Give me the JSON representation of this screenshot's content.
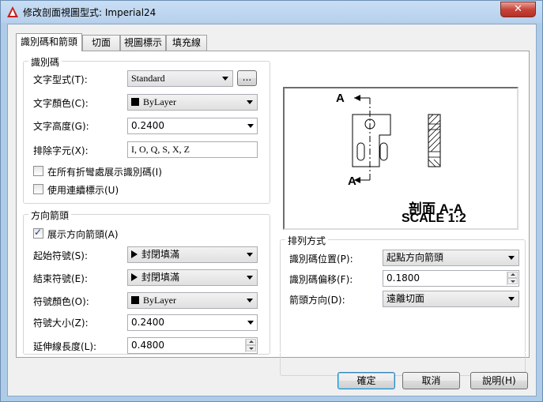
{
  "window": {
    "title": "修改剖面視圖型式: Imperial24",
    "close_glyph": "✕"
  },
  "tabs": [
    {
      "label": "識別碼和箭頭"
    },
    {
      "label": "切面"
    },
    {
      "label": "視圖標示"
    },
    {
      "label": "填充線"
    }
  ],
  "identifier": {
    "group_title": "識別碼",
    "text_style_label": "文字型式(T):",
    "text_style_value": "Standard",
    "text_style_browse": "...",
    "text_color_label": "文字顏色(C):",
    "text_color_value": "ByLayer",
    "text_height_label": "文字高度(G):",
    "text_height_value": "0.2400",
    "exclude_chars_label": "排除字元(X):",
    "exclude_chars_value": "I, O, Q, S, X, Z",
    "show_at_bends_label": "在所有折彎處展示識別碼(I)",
    "show_at_bends_checked": false,
    "continuous_label": "使用連續標示(U)",
    "continuous_checked": false
  },
  "direction_arrow": {
    "group_title": "方向箭頭",
    "show_label": "展示方向箭頭(A)",
    "show_checked": true,
    "start_symbol_label": "起始符號(S):",
    "start_symbol_value": "封閉填滿",
    "end_symbol_label": "結束符號(E):",
    "end_symbol_value": "封閉填滿",
    "symbol_color_label": "符號顏色(O):",
    "symbol_color_value": "ByLayer",
    "symbol_size_label": "符號大小(Z):",
    "symbol_size_value": "0.2400",
    "extension_length_label": "延伸線長度(L):",
    "extension_length_value": "0.4800"
  },
  "layout": {
    "group_title": "排列方式",
    "identifier_position_label": "識別碼位置(P):",
    "identifier_position_value": "起點方向箭頭",
    "identifier_offset_label": "識別碼偏移(F):",
    "identifier_offset_value": "0.1800",
    "arrow_direction_label": "箭頭方向(D):",
    "arrow_direction_value": "遠離切面"
  },
  "preview": {
    "marker_top": "A",
    "marker_bottom": "A",
    "caption_line1": "剖面 A-A",
    "caption_line2": "SCALE 1:2"
  },
  "buttons": {
    "ok": "確定",
    "cancel": "取消",
    "help": "說明(H)"
  },
  "colors": {
    "title_bar": "#b6d0ec",
    "close_button": "#c7443a",
    "preview_hatch": "#000000"
  }
}
